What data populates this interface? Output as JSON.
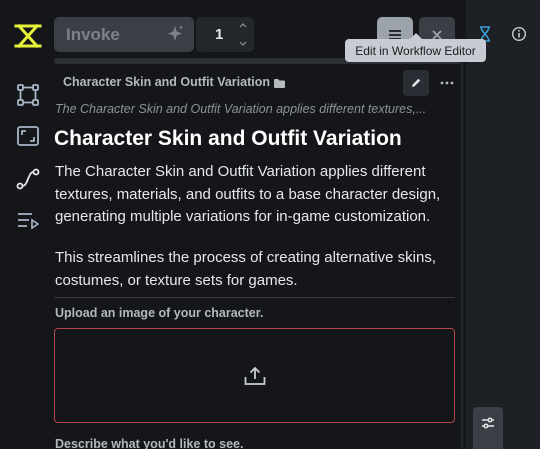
{
  "toolbar": {
    "invoke_label": "Invoke",
    "queue_count": "1"
  },
  "tooltip": {
    "text": "Edit in Workflow Editor"
  },
  "workflow": {
    "name": "Character Skin and Outfit Variation",
    "summary": "The Character Skin and Outfit Variation applies different textures,...",
    "title": "Character Skin and Outfit Variation",
    "description_1": "The Character Skin and Outfit Variation applies different textures, materials, and outfits to a base character design, generating multiple variations for in-game customization.",
    "description_2": "This streamlines the process of creating alternative skins, costumes, or texture sets for games."
  },
  "fields": {
    "image_label": "Upload an image of your character.",
    "prompt_label": "Describe what you'd like to see."
  },
  "colors": {
    "accent": "#e7f238",
    "error_border": "#b3464b",
    "queue_blue": "#3b9bd9"
  },
  "icons": [
    "logo-icon",
    "nodes-icon",
    "canvas-icon",
    "workflow-icon",
    "queue-list-icon",
    "sparkle-icon",
    "menu-icon",
    "close-icon",
    "hourglass-icon",
    "info-icon",
    "folder-icon",
    "pencil-icon",
    "ellipsis-icon",
    "upload-icon",
    "sliders-icon"
  ]
}
